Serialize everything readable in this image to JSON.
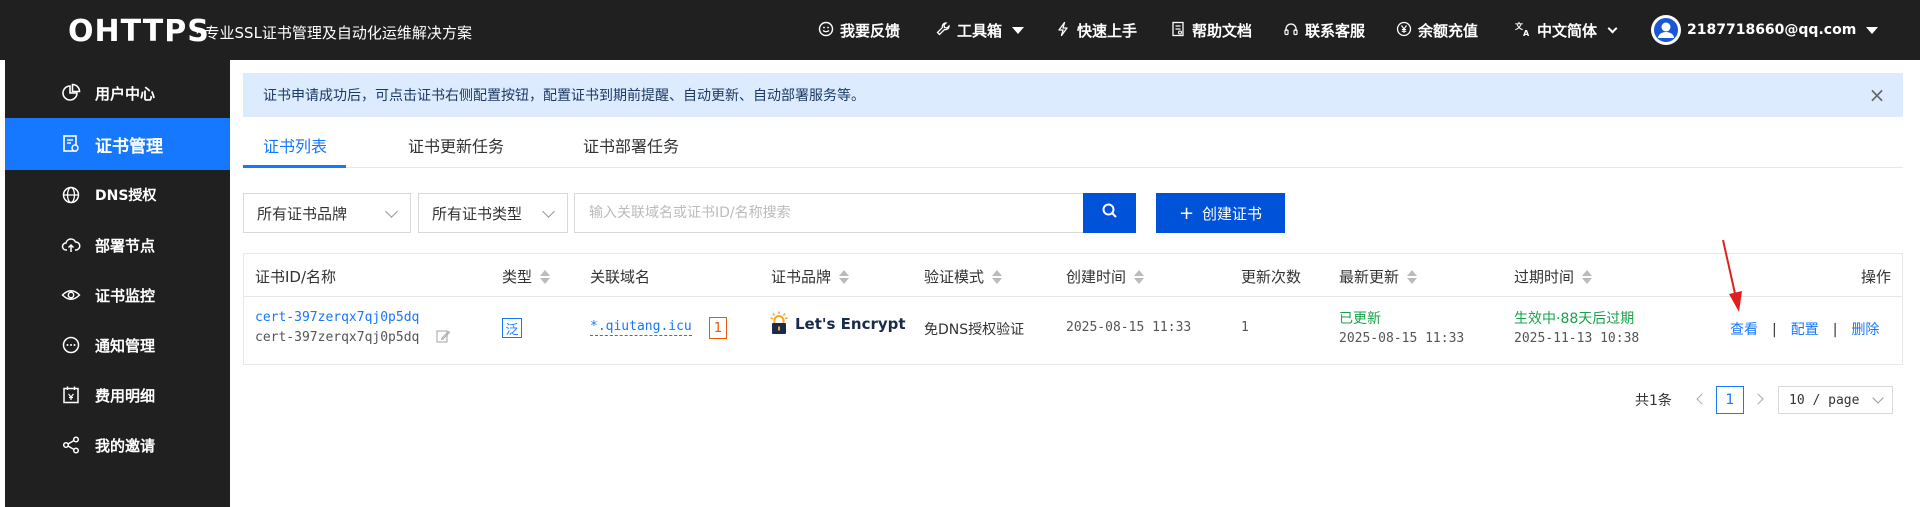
{
  "header": {
    "logo": "OHTTPS",
    "tagline": "· 专业SSL证书管理及自动化运维解决方案",
    "nav": [
      {
        "label": "我要反馈",
        "icon": "smile-icon"
      },
      {
        "label": "工具箱",
        "icon": "wrench-icon"
      },
      {
        "label": "快速上手",
        "icon": "bolt-icon"
      },
      {
        "label": "帮助文档",
        "icon": "doc-icon"
      },
      {
        "label": "联系客服",
        "icon": "headset-icon"
      },
      {
        "label": "余额充值",
        "icon": "yen-icon"
      },
      {
        "label": "中文简体",
        "icon": "translate-icon"
      }
    ],
    "user_email": "2187718660@qq.com"
  },
  "sidebar": {
    "items": [
      {
        "label": "用户中心",
        "icon": "pie-chart-icon"
      },
      {
        "label": "证书管理",
        "icon": "certificate-icon",
        "active": true
      },
      {
        "label": "DNS授权",
        "icon": "globe-icon"
      },
      {
        "label": "部署节点",
        "icon": "cloud-upload-icon"
      },
      {
        "label": "证书监控",
        "icon": "eye-icon"
      },
      {
        "label": "通知管理",
        "icon": "message-icon"
      },
      {
        "label": "费用明细",
        "icon": "calendar-icon"
      },
      {
        "label": "我的邀请",
        "icon": "share-icon"
      }
    ]
  },
  "notice": {
    "text": "证书申请成功后，可点击证书右侧配置按钮，配置证书到期前提醒、自动更新、自动部署服务等。",
    "close": "×"
  },
  "tabs": [
    {
      "label": "证书列表",
      "active": true
    },
    {
      "label": "证书更新任务"
    },
    {
      "label": "证书部署任务"
    }
  ],
  "filters": {
    "brand_select": "所有证书品牌",
    "type_select": "所有证书类型",
    "search_placeholder": "输入关联域名或证书ID/名称搜索",
    "create_button": "创建证书",
    "create_plus": "+"
  },
  "table": {
    "columns": [
      "证书ID/名称",
      "类型",
      "关联域名",
      "证书品牌",
      "验证模式",
      "创建时间",
      "更新次数",
      "最新更新",
      "过期时间",
      "操作"
    ],
    "rows": [
      {
        "cert_id": "cert-397zerqx7qj0p5dq",
        "cert_name": "cert-397zerqx7qj0p5dq",
        "type": "泛",
        "domain": "*.qiutang.icu",
        "domain_count": "1",
        "brand": "Let's Encrypt",
        "verify_mode": "免DNS授权验证",
        "created": "2025-08-15 11:33",
        "update_count": "1",
        "latest_status": "已更新",
        "latest_time": "2025-08-15 11:33",
        "expire_status": "生效中·88天后过期",
        "expire_time": "2025-11-13 10:38",
        "actions": [
          "查看",
          "配置",
          "删除"
        ],
        "separator": "|"
      }
    ]
  },
  "pagination": {
    "total": "共1条",
    "current_page": "1",
    "page_size": "10 / page"
  },
  "colors": {
    "header_bg": "#202020",
    "accent": "#1677ff",
    "primary_button": "#0052d9",
    "success": "#16a34a",
    "warning": "#e8590c",
    "notice_bg": "#dcebfd"
  }
}
